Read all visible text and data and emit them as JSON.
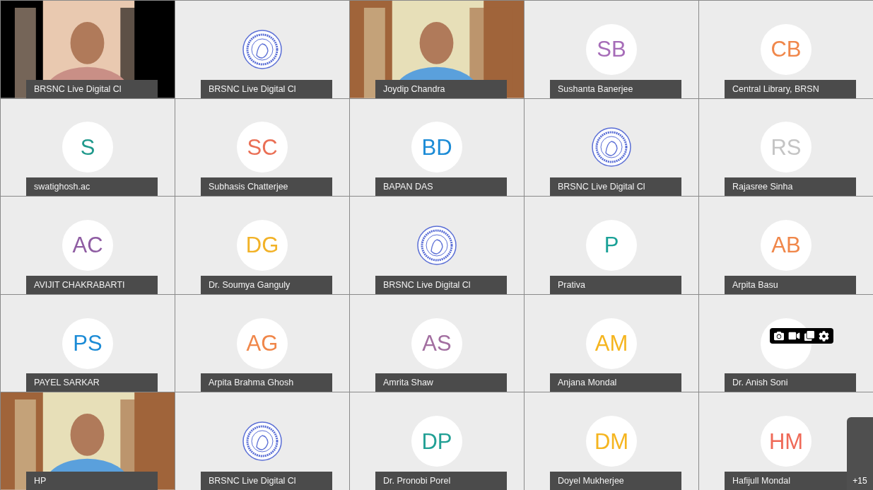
{
  "tiles": [
    {
      "kind": "video",
      "name": "BRSNC Live Digital Cl"
    },
    {
      "kind": "logo",
      "name": "BRSNC Live Digital Cl"
    },
    {
      "kind": "video",
      "name": "Joydip Chandra"
    },
    {
      "kind": "initials",
      "initials": "SB",
      "color": "#a66cb8",
      "name": "Sushanta Banerjee"
    },
    {
      "kind": "initials",
      "initials": "CB",
      "color": "#f0874a",
      "name": "Central Library, BRSN"
    },
    {
      "kind": "initials",
      "initials": "S",
      "color": "#20998c",
      "name": "swatighosh.ac"
    },
    {
      "kind": "initials",
      "initials": "SC",
      "color": "#ea6f55",
      "name": "Subhasis Chatterjee"
    },
    {
      "kind": "initials",
      "initials": "BD",
      "color": "#1b8bd6",
      "name": "BAPAN DAS"
    },
    {
      "kind": "logo",
      "name": "BRSNC Live Digital Cl"
    },
    {
      "kind": "initials",
      "initials": "RS",
      "color": "#c4c4c4",
      "name": "Rajasree Sinha"
    },
    {
      "kind": "initials",
      "initials": "AC",
      "color": "#8f5da3",
      "name": "AVIJIT CHAKRABARTI"
    },
    {
      "kind": "initials",
      "initials": "DG",
      "color": "#f2b227",
      "name": "Dr. Soumya Ganguly"
    },
    {
      "kind": "logo",
      "name": "BRSNC Live Digital Cl"
    },
    {
      "kind": "initials",
      "initials": "P",
      "color": "#1aa197",
      "name": "Prativa"
    },
    {
      "kind": "initials",
      "initials": "AB",
      "color": "#f0874a",
      "name": "Arpita Basu"
    },
    {
      "kind": "initials",
      "initials": "PS",
      "color": "#1b8bd6",
      "name": "PAYEL SARKAR"
    },
    {
      "kind": "initials",
      "initials": "AG",
      "color": "#f0874a",
      "name": "Arpita Brahma Ghosh"
    },
    {
      "kind": "initials",
      "initials": "AS",
      "color": "#a26ea0",
      "name": "Amrita Shaw"
    },
    {
      "kind": "initials",
      "initials": "AM",
      "color": "#f5b51f",
      "name": "Anjana Mondal"
    },
    {
      "kind": "initials",
      "name": "Dr. Anish Soni"
    },
    {
      "kind": "video",
      "name": "HP"
    },
    {
      "kind": "logo",
      "name": "BRSNC Live Digital Cl"
    },
    {
      "kind": "initials",
      "initials": "DP",
      "color": "#22a095",
      "name": "Dr. Pronobi Porel"
    },
    {
      "kind": "initials",
      "initials": "DM",
      "color": "#f5b51f",
      "name": "Doyel Mukherjee"
    },
    {
      "kind": "initials",
      "initials": "HM",
      "color": "#ef6a58",
      "name": "Hafijull Mondal"
    }
  ],
  "more_count": "+15"
}
